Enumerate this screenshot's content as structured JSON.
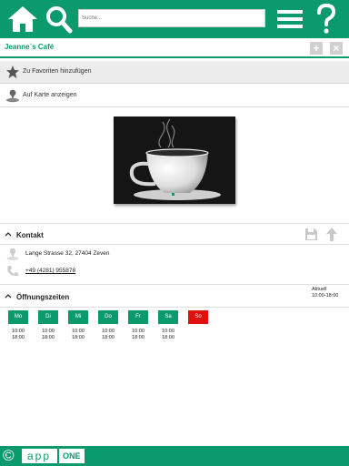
{
  "header": {
    "icons": {
      "home": "home-icon",
      "search": "search-icon",
      "menu": "menu-icon",
      "help": "help-icon"
    },
    "search_placeholder": "Suche..."
  },
  "title_bar": {
    "title": "Jeanne`s Café",
    "add_label": "+",
    "close_label": "×"
  },
  "actions": [
    {
      "label": "Zu Favoriten hinzufügen",
      "icon": "star-icon"
    },
    {
      "label": "Auf Karte anzeigen",
      "icon": "map-pin-icon"
    }
  ],
  "image": {
    "subject": "white coffee cup with steam on black background"
  },
  "contact": {
    "heading": "Kontakt",
    "address": "Lange Strasse 32, 27404 Zeven",
    "phone": "+49 (4281) 955878",
    "icons": {
      "save": "save-icon",
      "upload": "upload-icon"
    }
  },
  "opening_hours": {
    "heading": "Öffnungszeiten",
    "current_label": "Aktuell",
    "current_hours": "10:00-18:00",
    "days": [
      {
        "label": "Mo",
        "open": "10:00",
        "close": "18:00"
      },
      {
        "label": "Di",
        "open": "10:00",
        "close": "18:00"
      },
      {
        "label": "Mi",
        "open": "10:00",
        "close": "18:00"
      },
      {
        "label": "Do",
        "open": "10:00",
        "close": "18:00"
      },
      {
        "label": "Fr",
        "open": "10:00",
        "close": "18:00"
      },
      {
        "label": "Sa",
        "open": "10:00",
        "close": "18:00"
      },
      {
        "label": "So",
        "open": "",
        "close": ""
      }
    ]
  },
  "footer": {
    "copyright": "©",
    "brand_app": "app",
    "brand_one": "ONE"
  },
  "colors": {
    "accent": "#0a9a6c",
    "closed": "#e01010",
    "link": "#1a3fd0"
  }
}
